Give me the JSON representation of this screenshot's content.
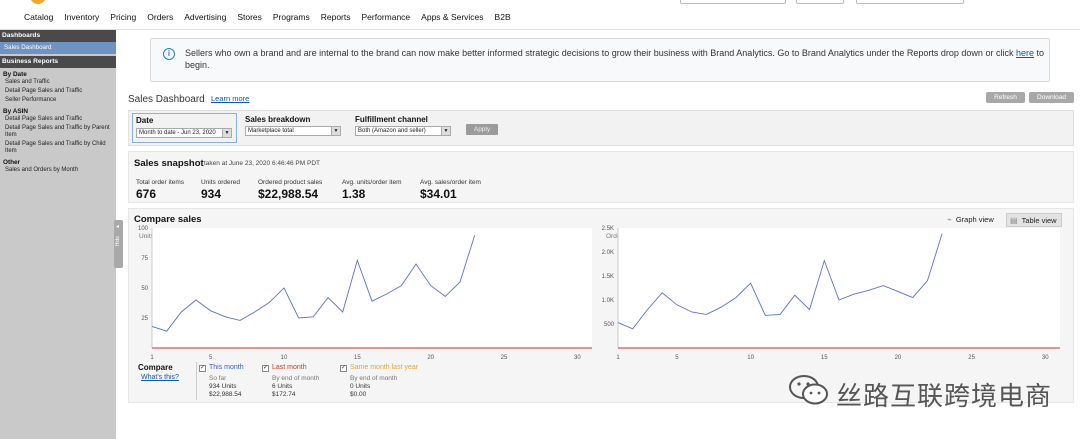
{
  "topnav": {
    "items": [
      "Catalog",
      "Inventory",
      "Pricing",
      "Orders",
      "Advertising",
      "Stores",
      "Programs",
      "Reports",
      "Performance",
      "Apps & Services",
      "B2B"
    ]
  },
  "sidebar": {
    "dashboards_header": "Dashboards",
    "sales_dashboard": "Sales Dashboard",
    "business_reports_header": "Business Reports",
    "by_date": "By Date",
    "by_date_items": [
      "Sales and Traffic",
      "Detail Page Sales and Traffic",
      "Seller Performance"
    ],
    "by_asin": "By ASIN",
    "by_asin_items": [
      "Detail Page Sales and Traffic",
      "Detail Page Sales and Traffic by Parent Item",
      "Detail Page Sales and Traffic by Child Item"
    ],
    "other": "Other",
    "other_items": [
      "Sales and Orders by Month"
    ],
    "collapse_label": "Hide"
  },
  "banner": {
    "text_before": "Sellers who own a brand and are internal to the brand can now make better informed strategic decisions to grow their business with Brand Analytics. Go to Brand Analytics under the Reports drop down or click ",
    "link": "here",
    "text_after": " to begin."
  },
  "dashboard": {
    "title": "Sales Dashboard",
    "learn_more": "Learn more",
    "refresh": "Refresh",
    "download": "Download"
  },
  "filters": {
    "date_label": "Date",
    "date_value": "Month to date - Jun 23, 2020",
    "breakdown_label": "Sales breakdown",
    "breakdown_value": "Marketplace total",
    "fulfillment_label": "Fulfillment channel",
    "fulfillment_value": "Both (Amazon and seller)",
    "apply": "Apply"
  },
  "snapshot": {
    "title": "Sales snapshot",
    "taken_at": "taken at June 23, 2020 6:46:46 PM PDT",
    "metrics": [
      {
        "label": "Total order items",
        "value": "676"
      },
      {
        "label": "Units ordered",
        "value": "934"
      },
      {
        "label": "Ordered product sales",
        "value": "$22,988.54"
      },
      {
        "label": "Avg. units/order item",
        "value": "1.38"
      },
      {
        "label": "Avg. sales/order item",
        "value": "$34.01"
      }
    ]
  },
  "compare": {
    "title": "Compare sales",
    "graph_view": "Graph view",
    "table_view": "Table view"
  },
  "chart_data": [
    {
      "type": "line",
      "title": "Units ordered",
      "xlabel": "",
      "ylabel": "",
      "x_ticks": [
        "1",
        "5",
        "10",
        "15",
        "20",
        "25",
        "30"
      ],
      "y_ticks": [
        "25",
        "50",
        "75",
        "100"
      ],
      "xlim": [
        1,
        31
      ],
      "ylim": [
        0,
        100
      ],
      "series": [
        {
          "name": "This month",
          "color": "#5b6fd6",
          "x": [
            1,
            2,
            3,
            4,
            5,
            6,
            7,
            8,
            9,
            10,
            11,
            12,
            13,
            14,
            15,
            16,
            17,
            18,
            19,
            20,
            21,
            22,
            23
          ],
          "y": [
            18,
            14,
            30,
            40,
            31,
            26,
            23,
            30,
            38,
            50,
            25,
            26,
            42,
            30,
            73,
            39,
            45,
            52,
            70,
            52,
            43,
            55,
            94
          ]
        },
        {
          "name": "Last month",
          "color": "#d9534f",
          "x": [
            1,
            31
          ],
          "y": [
            0,
            0
          ]
        }
      ]
    },
    {
      "type": "line",
      "title": "Ordered product sales",
      "xlabel": "",
      "ylabel": "",
      "x_ticks": [
        "1",
        "5",
        "10",
        "15",
        "20",
        "25",
        "30"
      ],
      "y_ticks": [
        "500",
        "1.0K",
        "1.5K",
        "2.0K",
        "2.5K"
      ],
      "xlim": [
        1,
        31
      ],
      "ylim": [
        0,
        2500
      ],
      "series": [
        {
          "name": "This month",
          "color": "#5b6fd6",
          "x": [
            1,
            2,
            3,
            4,
            5,
            6,
            7,
            8,
            9,
            10,
            11,
            12,
            13,
            14,
            15,
            16,
            17,
            18,
            19,
            20,
            21,
            22,
            23
          ],
          "y": [
            530,
            400,
            800,
            1150,
            900,
            750,
            700,
            850,
            1050,
            1350,
            680,
            700,
            1100,
            800,
            1820,
            1000,
            1120,
            1200,
            1300,
            1180,
            1050,
            1400,
            2380
          ]
        },
        {
          "name": "Last month",
          "color": "#d9534f",
          "x": [
            1,
            31
          ],
          "y": [
            0,
            0
          ]
        }
      ]
    }
  ],
  "legend": {
    "title": "Compare",
    "whats_this": "What's this?",
    "items": [
      {
        "name": "This month",
        "color": "#3a5fc4",
        "line1": "So far",
        "line2": "934 Units",
        "line3": "$22,988.54"
      },
      {
        "name": "Last month",
        "color": "#c83a2a",
        "line1": "By end of month",
        "line2": "6 Units",
        "line3": "$172.74"
      },
      {
        "name": "Same month last year",
        "color": "#e0a53a",
        "line1": "By end of month",
        "line2": "0 Units",
        "line3": "$0.00"
      }
    ]
  },
  "watermark": {
    "text": "丝路互联跨境电商"
  }
}
